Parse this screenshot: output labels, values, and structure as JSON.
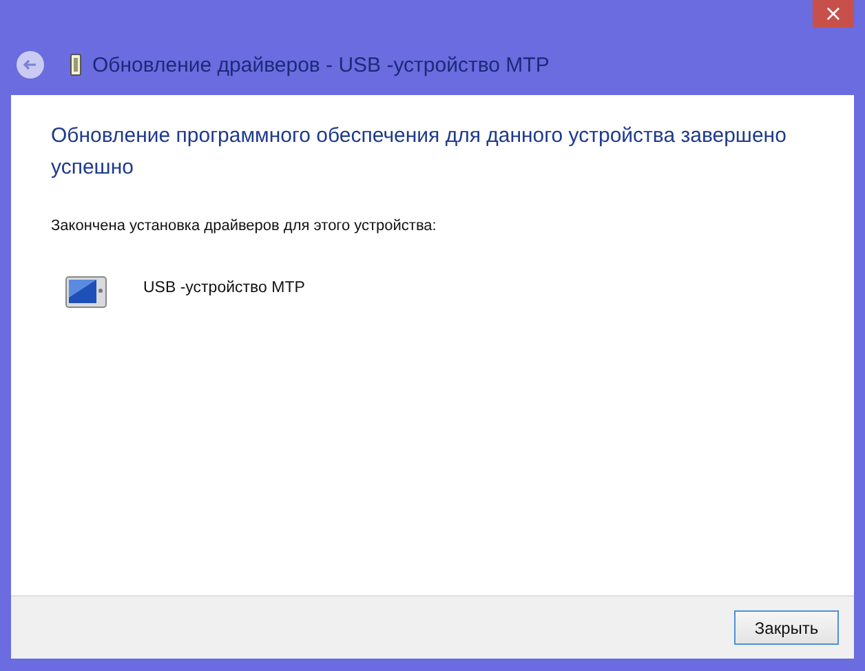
{
  "window": {
    "title": "Обновление драйверов - USB -устройство MTP",
    "close_glyph": "×"
  },
  "heading": "Обновление программного обеспечения для данного устройства завершено успешно",
  "message": "Закончена установка драйверов для этого устройства:",
  "device": {
    "name": "USB -устройство MTP"
  },
  "buttons": [
    "Закрыть"
  ]
}
